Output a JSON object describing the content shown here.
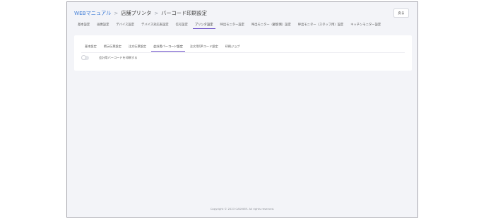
{
  "breadcrumb": {
    "root": "WEBマニュアル",
    "separator": ">",
    "level1": "店舗プリンタ",
    "level2": "バーコード印刷設定"
  },
  "back_button": {
    "label": "戻る"
  },
  "tabs": [
    {
      "label": "基本設定",
      "active": false
    },
    {
      "label": "画像設定",
      "active": false
    },
    {
      "label": "デバイス設定",
      "active": false
    },
    {
      "label": "デバイス対応表設定",
      "active": false
    },
    {
      "label": "信号設定",
      "active": false
    },
    {
      "label": "プリンタ設定",
      "active": true
    },
    {
      "label": "呼出モニター設定",
      "active": false
    },
    {
      "label": "呼出モニター（顧客側）設定",
      "active": false
    },
    {
      "label": "呼出モニター（スタッフ用）設定",
      "active": false
    },
    {
      "label": "キッチンモニター設定",
      "active": false
    }
  ],
  "subtabs": [
    {
      "label": "基本設定",
      "active": false
    },
    {
      "label": "掲示伝票設定",
      "active": false
    },
    {
      "label": "注文伝票設定",
      "active": false
    },
    {
      "label": "会計用バーコード設定",
      "active": true
    },
    {
      "label": "注文用QRコード設定",
      "active": false
    },
    {
      "label": "印刷ジョブ",
      "active": false
    }
  ],
  "toggle": {
    "label": "会計用バーコードを印刷する",
    "on": false
  },
  "footer": {
    "copyright": "Copyright © 2023 CASHIER. All rights reserved."
  },
  "colors": {
    "accent": "#6b4fc8",
    "link": "#3d7bd6",
    "background": "#f3f4f8"
  }
}
